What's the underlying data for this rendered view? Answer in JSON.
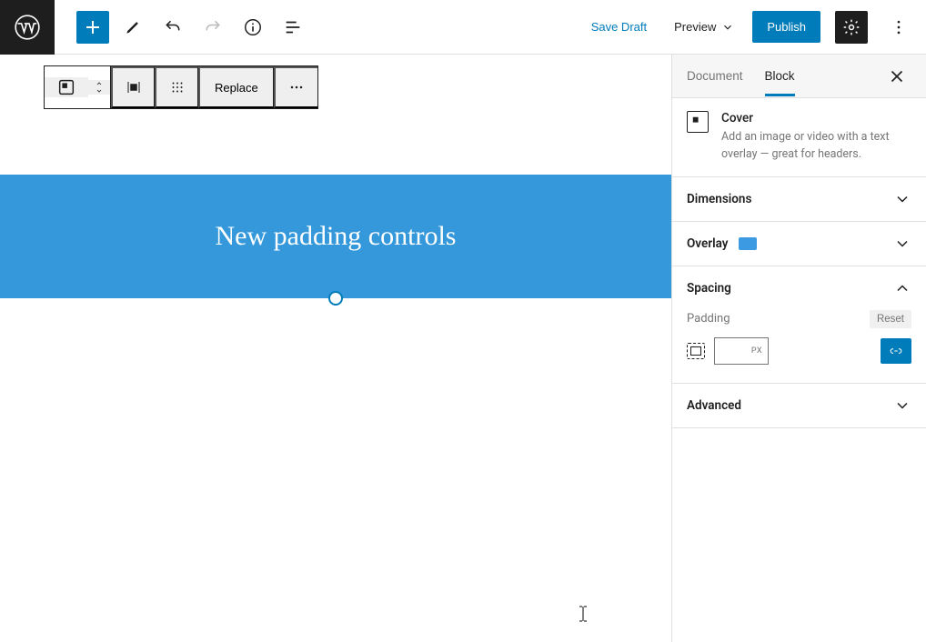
{
  "topbar": {
    "save_draft": "Save Draft",
    "preview": "Preview",
    "publish": "Publish"
  },
  "block_toolbar": {
    "replace": "Replace"
  },
  "cover": {
    "title": "New padding controls",
    "overlay_color": "#3b9ae1"
  },
  "sidebar": {
    "tabs": {
      "document": "Document",
      "block": "Block"
    },
    "block_header": {
      "name": "Cover",
      "description": "Add an image or video with a text overlay — great for headers."
    },
    "panels": {
      "dimensions": "Dimensions",
      "overlay": "Overlay",
      "spacing": "Spacing",
      "advanced": "Advanced"
    },
    "spacing": {
      "padding_label": "Padding",
      "reset": "Reset",
      "value": "",
      "unit": "PX"
    }
  }
}
